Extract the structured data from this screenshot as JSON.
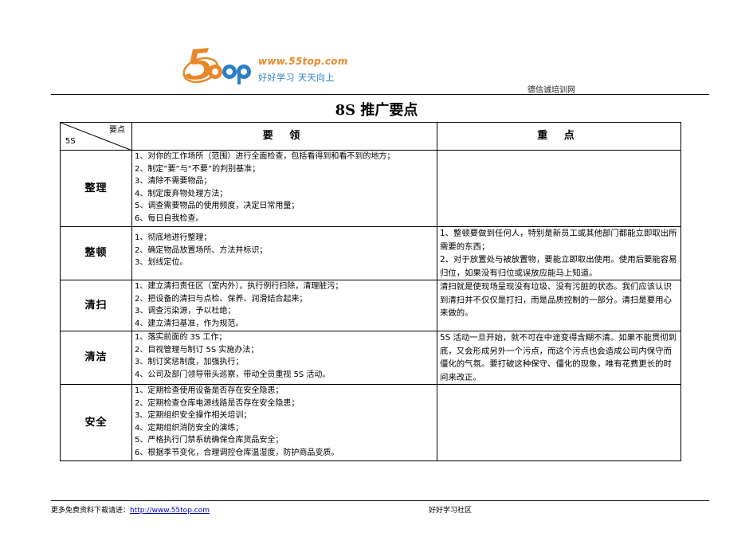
{
  "logo": {
    "mark_text": "5top",
    "url_text": "www.55top.com",
    "slogan": "好好学习  天天向上"
  },
  "header": {
    "right_text": "德信诚培训网"
  },
  "title": "8S 推广要点",
  "table": {
    "corner_top": "要点",
    "corner_bottom": "5S",
    "col_main": "要  领",
    "col_key": "重  点",
    "rows": [
      {
        "name": "整理",
        "points": [
          "1、对你的工作场所（范围）进行全面检查，包括看得到和看不到的地方；",
          "2、制定“要”与“不要”的判别基准；",
          "3、清除不需要物品；",
          "4、制定废弃物处理方法；",
          "5、调查需要物品的使用频度，决定日常用量；",
          "6、每日自我检查。"
        ],
        "key": ""
      },
      {
        "name": "整顿",
        "points": [
          "1、彻底地进行整理；",
          "2、确定物品放置场所、方法并标识；",
          "3、划线定位。"
        ],
        "key": "1、整顿要做到任何人，特别是新员工或其他部门都能立即取出所需要的东西；\n2、对于放置处与被放置物，要能立即取出使用。使用后要能容易归位，如果没有归位或误放应能马上知道。"
      },
      {
        "name": "清扫",
        "points": [
          "1、建立清扫责任区（室内外）。执行例行扫除，清理脏污；",
          "2、把设备的清扫与点检、保养、润滑结合起来；",
          "3、调查污染源，予以杜绝；",
          "4、建立清扫基准，作为规范。"
        ],
        "key": "清扫就是使现场呈现没有垃圾、没有污脏的状态。我们应该认识到清扫并不仅仅是打扫，而是品质控制的一部分。清扫是要用心来做的。"
      },
      {
        "name": "清洁",
        "points": [
          "1、落实前面的 3S 工作；",
          "2、目视管理与制订 5S 实施办法；",
          "3、制订奖惩制度，加强执行；",
          "4、公司及部门领导带头巡察，带动全员重视 5S 活动。"
        ],
        "key": "5S 活动一旦开始，就不可在中途变得含糊不清。如果不能贯彻到底，又会形成另外一个污点，而这个污点也会造成公司内保守而僵化的气氛。要打破这种保守、僵化的现象，唯有花费更长的时间来改正。"
      },
      {
        "name": "安全",
        "points": [
          "1、定期检查使用设备是否存在安全隐患；",
          "2、定期检查仓库电源线路是否存在安全隐患；",
          "3、定期组织安全操作相关培训；",
          "4、定期组织消防安全的演练；",
          "5、严格执行门禁系统确保仓库货品安全；",
          "6、根据季节变化，合理调控仓库温湿度，防护商品变质。"
        ],
        "key": ""
      }
    ]
  },
  "footer": {
    "left_text": "更多免费资料下载请进：",
    "link_text": "http://www.55top.com",
    "mid_text": "好好学习社区"
  },
  "colors": {
    "logo_orange": "#e8872a",
    "logo_blue": "#2a80c8",
    "link": "#0000cc"
  }
}
